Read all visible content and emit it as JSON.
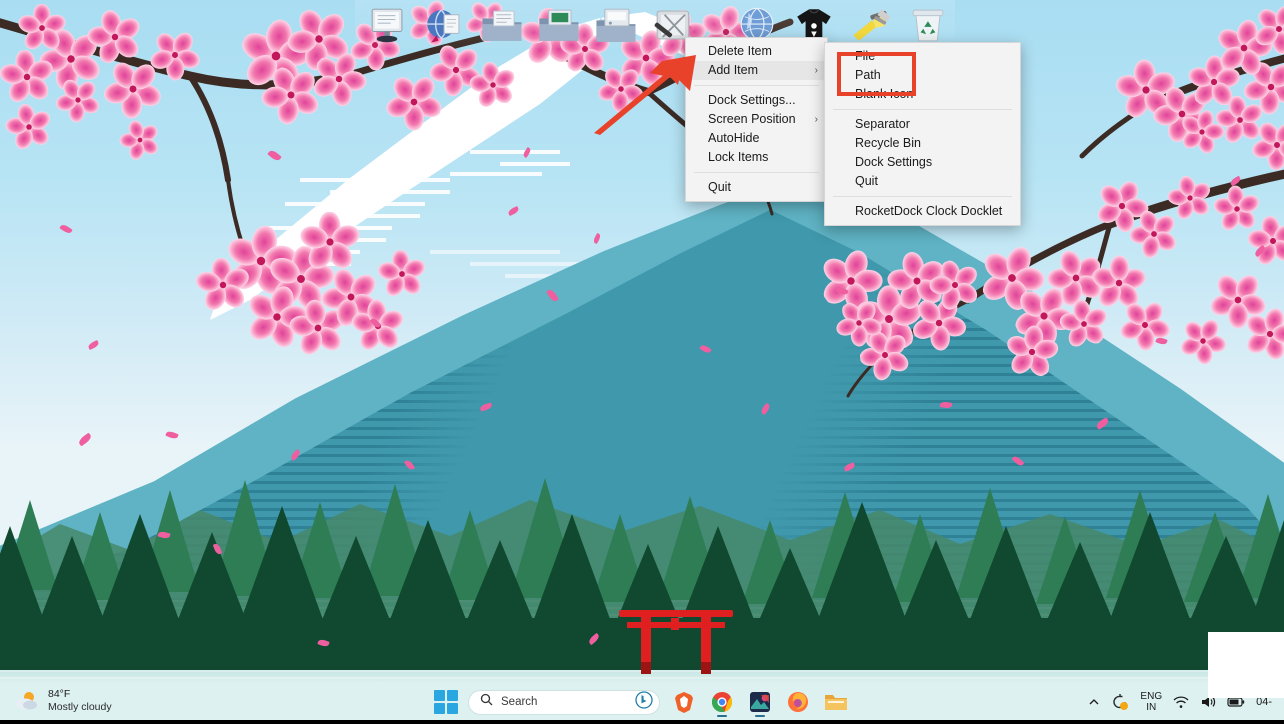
{
  "desktop": {
    "wallpaper_description": "Cherry blossom branches over Mount Fuji with pine forest, lake and red torii gate",
    "colors": {
      "sky_top": "#a9ddf2",
      "sky_bottom": "#e9f4f8",
      "mountain_back": "#5fb3c4",
      "mountain_front": "#3f98ab",
      "forest_dark": "#0f4a35",
      "forest_mid": "#2e7d55",
      "water": "#47a3a2",
      "torii_red": "#e02020",
      "blossom_pink": "#f277ad",
      "branch_brown": "#3b2b24",
      "accent_red": "#e8432a",
      "taskbar": "#dcf1f0"
    }
  },
  "dock": {
    "name": "RocketDock",
    "items": [
      {
        "label": "Display Properties",
        "icon": "monitor-icon"
      },
      {
        "label": "Internet",
        "icon": "globe-document-icon"
      },
      {
        "label": "Documents",
        "icon": "folder-icon"
      },
      {
        "label": "Pictures",
        "icon": "folder-green-icon"
      },
      {
        "label": "My Computer",
        "icon": "folder-computer-icon"
      },
      {
        "label": "Tools",
        "icon": "tools-icon"
      },
      {
        "label": "Internet Explorer",
        "icon": "globe-icon"
      },
      {
        "label": "Apparel",
        "icon": "tshirt-icon"
      },
      {
        "label": "Paint Tools",
        "icon": "hammer-brush-icon"
      },
      {
        "label": "Recycle Bin",
        "icon": "recycle-bin-icon"
      }
    ]
  },
  "context_menu": {
    "items": [
      {
        "label": "Delete Item",
        "submenu": false,
        "highlighted": false
      },
      {
        "label": "Add Item",
        "submenu": true,
        "highlighted": true
      },
      {
        "separator_after": true
      },
      {
        "label": "Dock Settings...",
        "submenu": false,
        "highlighted": false
      },
      {
        "label": "Screen Position",
        "submenu": true,
        "highlighted": false
      },
      {
        "label": "AutoHide",
        "submenu": false,
        "highlighted": false
      },
      {
        "label": "Lock Items",
        "submenu": false,
        "highlighted": false
      },
      {
        "label": "Quit",
        "submenu": false,
        "highlighted": false
      }
    ],
    "list": {
      "delete_item": "Delete Item",
      "add_item": "Add Item",
      "dock_settings": "Dock Settings...",
      "screen_position": "Screen Position",
      "autohide": "AutoHide",
      "lock_items": "Lock Items",
      "quit": "Quit"
    },
    "submenu_arrow": "›"
  },
  "submenu": {
    "items": {
      "file": "File",
      "path": "Path",
      "blank_icon": "Blank Icon",
      "separator": "Separator",
      "recycle_bin": "Recycle Bin",
      "dock_settings": "Dock Settings",
      "quit": "Quit",
      "rocketdock_clock_docklet": "RocketDock Clock Docklet"
    },
    "highlight_box": {
      "covers": [
        "File",
        "Path"
      ],
      "color": "#e8432a"
    }
  },
  "annotation": {
    "arrow_color": "#e8432a",
    "arrow_points_to": "Add Item"
  },
  "taskbar": {
    "weather": {
      "temperature": "84°F",
      "condition": "Mostly cloudy",
      "icon": "sun-cloud-icon"
    },
    "start_button": "start-button",
    "search": {
      "placeholder": "Search",
      "icon": "search-icon",
      "copilot_icon": "bing-chat-icon"
    },
    "apps": [
      {
        "name": "Brave",
        "icon": "brave-icon",
        "running": false
      },
      {
        "name": "Google Chrome",
        "icon": "chrome-icon",
        "running": true
      },
      {
        "name": "Photos",
        "icon": "photos-icon",
        "running": true
      },
      {
        "name": "Mozilla Firefox",
        "icon": "firefox-icon",
        "running": false
      },
      {
        "name": "File Explorer",
        "icon": "file-explorer-icon",
        "running": false
      }
    ],
    "tray": {
      "overflow_icon": "chevron-up-icon",
      "update_icon": "windows-update-icon",
      "language_line1": "ENG",
      "language_line2": "IN",
      "wifi_icon": "wifi-icon",
      "volume_icon": "speaker-icon",
      "battery_icon": "battery-icon",
      "date": "04-"
    }
  }
}
